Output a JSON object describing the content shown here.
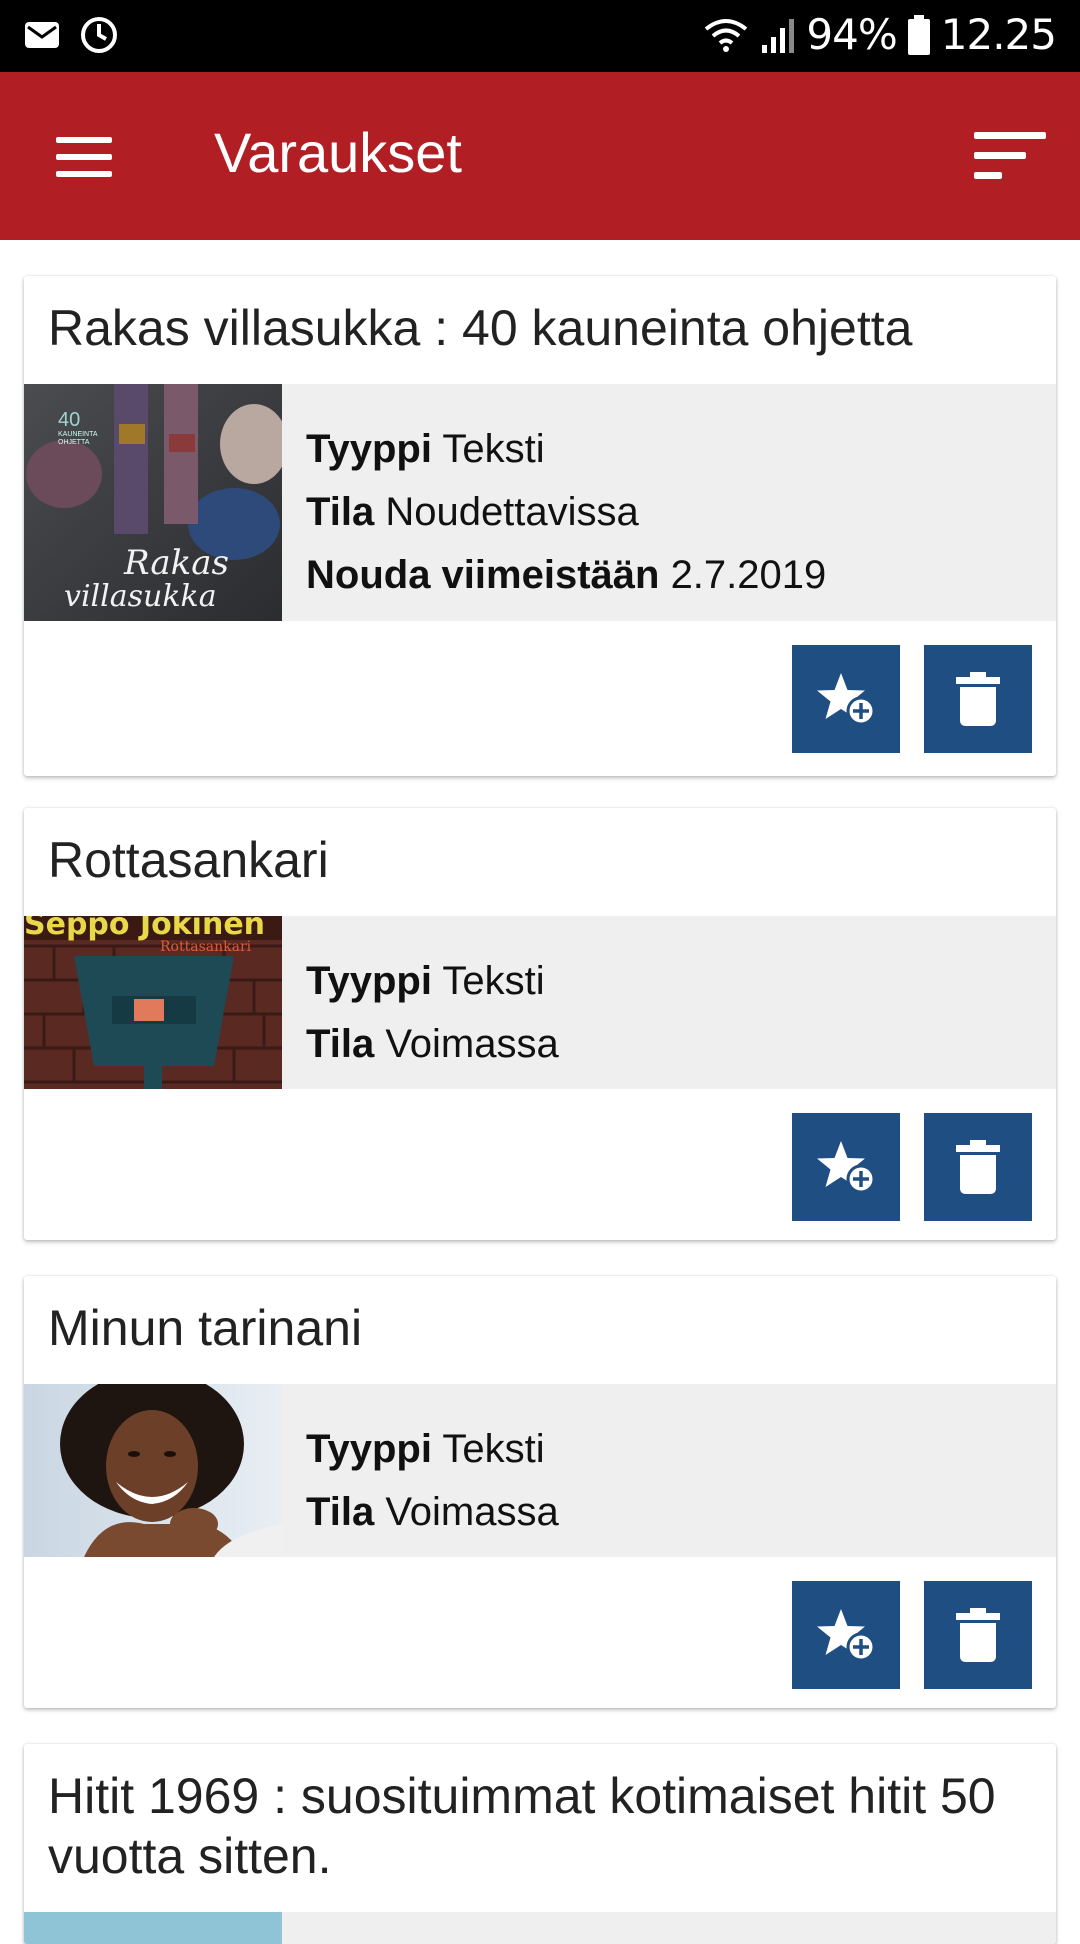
{
  "status_bar": {
    "battery": "94%",
    "time": "12.25",
    "icons": [
      "mail-icon",
      "sync-icon",
      "wifi-icon",
      "signal-icon",
      "battery-icon"
    ]
  },
  "app_bar": {
    "title": "Varaukset",
    "color": "#b11f24",
    "icons": [
      "menu-icon",
      "sort-icon"
    ]
  },
  "labels": {
    "type": "Tyyppi",
    "status": "Tila",
    "pickup": "Nouda viimeistään"
  },
  "action_color": "#1f4e82",
  "reservations": [
    {
      "title": "Rakas villasukka : 40 kauneinta ohjetta",
      "type": "Teksti",
      "status": "Noudettavissa",
      "pickup_by": "2.7.2019",
      "cover_text": [
        "40",
        "KAUNEINTA",
        "OHJETTA",
        "Rakas",
        "villasukka"
      ]
    },
    {
      "title": "Rottasankari",
      "type": "Teksti",
      "status": "Voimassa",
      "cover_text": [
        "Seppo Jokinen",
        "Rottasankari"
      ]
    },
    {
      "title": "Minun tarinani",
      "type": "Teksti",
      "status": "Voimassa"
    },
    {
      "title": "Hitit 1969 : suosituimmat kotimaiset hitit 50 vuotta sitten."
    }
  ]
}
